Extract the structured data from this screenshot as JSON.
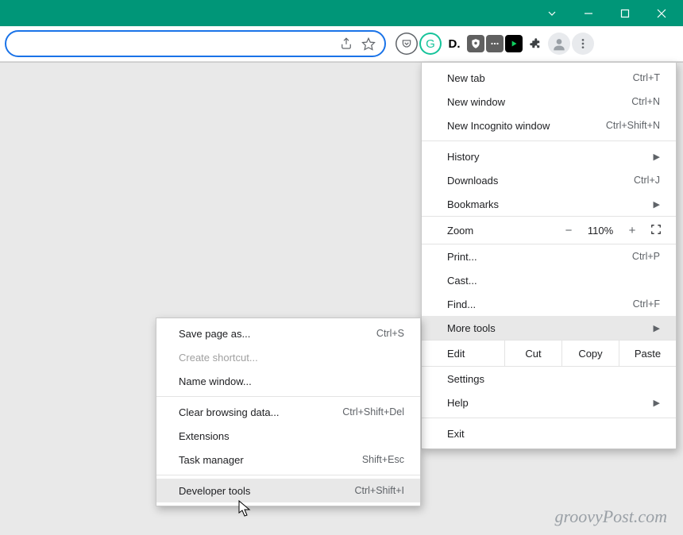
{
  "titlebar": {
    "color": "#009678"
  },
  "toolbar": {
    "share_icon": "share-icon",
    "star_icon": "star-icon",
    "extensions": [
      {
        "name": "pocket-icon",
        "glyph": "pocket"
      },
      {
        "name": "grammarly-icon",
        "glyph": "G",
        "bg": "#ffffff",
        "fg": "#15c39a",
        "circleBorder": "#15c39a"
      },
      {
        "name": "d-icon",
        "glyph": "D.",
        "bg": "#ffffff",
        "fg": "#000000",
        "bold": true
      },
      {
        "name": "ublock-icon",
        "glyph": "shield",
        "bg": "#606060",
        "fg": "#ffffff"
      },
      {
        "name": "square-icon",
        "glyph": "dots",
        "bg": "#606060",
        "fg": "#ffffff"
      },
      {
        "name": "play-icon",
        "glyph": "play",
        "bg": "#000000",
        "fg": "#10d060"
      },
      {
        "name": "puzzle-icon",
        "glyph": "puzzle",
        "bg": "",
        "fg": "#3c4043"
      },
      {
        "name": "profile-icon",
        "glyph": "profile",
        "bg": "#e8eaed",
        "fg": "#9aa0a6"
      },
      {
        "name": "menu-icon",
        "glyph": "dotsv",
        "bg": "#e8eaed",
        "fg": "#5f6368"
      }
    ]
  },
  "main_menu": {
    "items_a": [
      {
        "label": "New tab",
        "shortcut": "Ctrl+T"
      },
      {
        "label": "New window",
        "shortcut": "Ctrl+N"
      },
      {
        "label": "New Incognito window",
        "shortcut": "Ctrl+Shift+N"
      }
    ],
    "items_b": [
      {
        "label": "History",
        "arrow": true
      },
      {
        "label": "Downloads",
        "shortcut": "Ctrl+J"
      },
      {
        "label": "Bookmarks",
        "arrow": true
      }
    ],
    "zoom": {
      "label": "Zoom",
      "value": "110%"
    },
    "items_c": [
      {
        "label": "Print...",
        "shortcut": "Ctrl+P"
      },
      {
        "label": "Cast..."
      },
      {
        "label": "Find...",
        "shortcut": "Ctrl+F"
      },
      {
        "label": "More tools",
        "arrow": true,
        "hover": true
      }
    ],
    "edit": {
      "label": "Edit",
      "cut": "Cut",
      "copy": "Copy",
      "paste": "Paste"
    },
    "items_d": [
      {
        "label": "Settings"
      },
      {
        "label": "Help",
        "arrow": true
      }
    ],
    "items_e": [
      {
        "label": "Exit"
      }
    ]
  },
  "submenu": {
    "items_a": [
      {
        "label": "Save page as...",
        "shortcut": "Ctrl+S"
      },
      {
        "label": "Create shortcut...",
        "disabled": true
      },
      {
        "label": "Name window..."
      }
    ],
    "items_b": [
      {
        "label": "Clear browsing data...",
        "shortcut": "Ctrl+Shift+Del"
      },
      {
        "label": "Extensions"
      },
      {
        "label": "Task manager",
        "shortcut": "Shift+Esc"
      }
    ],
    "items_c": [
      {
        "label": "Developer tools",
        "shortcut": "Ctrl+Shift+I",
        "hover": true
      }
    ]
  },
  "watermark": "groovyPost.com"
}
